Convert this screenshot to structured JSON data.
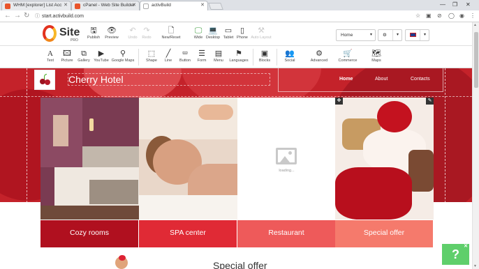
{
  "browser": {
    "tabs": [
      {
        "label": "WHM [explorer] List Acc"
      },
      {
        "label": "cPanel - Web Site Builder"
      },
      {
        "label": "activBuild"
      }
    ],
    "url": "start.activbuild.com"
  },
  "builder": {
    "logo_word": "Site",
    "logo_sub": "PRO",
    "toolbar": {
      "publish": "Publish",
      "preview": "Preview",
      "undo": "Undo",
      "redo": "Redo",
      "new_reset": "New/Reset",
      "wide": "Wide",
      "desktop": "Desktop",
      "tablet": "Tablet",
      "phone": "Phone",
      "auto_layout": "Auto Layout"
    },
    "page_select": "Home",
    "language_flag": "UK flag"
  },
  "elements": {
    "text": "Text",
    "picture": "Picture",
    "gallery": "Gallery",
    "youtube": "YouTube",
    "google_maps": "Google Maps",
    "shape": "Shape",
    "line": "Line",
    "button": "Button",
    "form": "Form",
    "menu": "Menu",
    "languages": "Languages",
    "blocks": "Blocks",
    "social": "Social",
    "advanced": "Advanced",
    "commerce": "Commerce",
    "maps": "Maps"
  },
  "site": {
    "title": "Cherry Hotel",
    "menu": [
      "Home",
      "About",
      "Contacts"
    ],
    "tiles": [
      {
        "label": "Cozy rooms",
        "color": "#b0101f"
      },
      {
        "label": "SPA center",
        "color": "#e02a35"
      },
      {
        "label": "Restaurant",
        "color": "#ee5a5a"
      },
      {
        "label": "Special offer",
        "color": "#f57a6c"
      }
    ],
    "loading_text": "loading...",
    "section_heading": "Special offer"
  },
  "help": {
    "label": "?"
  },
  "colors": {
    "hero_red": "#c4222a",
    "help_green": "#5fcf6b"
  }
}
